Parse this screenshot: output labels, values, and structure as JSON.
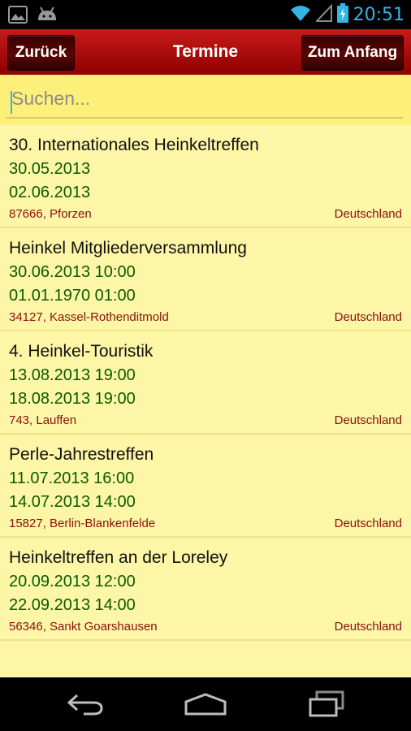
{
  "status_bar": {
    "time": "20:51",
    "icons": [
      "gallery-icon",
      "android-icon",
      "wifi-icon",
      "signal-icon",
      "battery-charging-icon"
    ]
  },
  "app_bar": {
    "back_label": "Zurück",
    "title": "Termine",
    "home_label": "Zum Anfang"
  },
  "search": {
    "placeholder": "Suchen..."
  },
  "events": [
    {
      "title": "30. Internationales Heinkeltreffen",
      "start": "30.05.2013",
      "end": "02.06.2013",
      "place": "87666, Pforzen",
      "country": "Deutschland"
    },
    {
      "title": "Heinkel Mitgliederversammlung",
      "start": "30.06.2013 10:00",
      "end": "01.01.1970 01:00",
      "place": "34127, Kassel-Rothenditmold",
      "country": "Deutschland"
    },
    {
      "title": "4. Heinkel-Touristik",
      "start": "13.08.2013 19:00",
      "end": "18.08.2013 19:00",
      "place": "743, Lauffen",
      "country": "Deutschland"
    },
    {
      "title": "Perle-Jahrestreffen",
      "start": "11.07.2013 16:00",
      "end": "14.07.2013 14:00",
      "place": "15827, Berlin-Blankenfelde",
      "country": "Deutschland"
    },
    {
      "title": "Heinkeltreffen an der Loreley",
      "start": "20.09.2013 12:00",
      "end": "22.09.2013 14:00",
      "place": "56346, Sankt Goarshausen",
      "country": "Deutschland"
    }
  ],
  "nav_bar": {
    "icons": [
      "back-nav-icon",
      "home-nav-icon",
      "recent-apps-icon"
    ]
  },
  "colors": {
    "app_bar": "#b50000",
    "background": "#fdf6a6",
    "search_background": "#fdf07a",
    "date_text": "#0a5a00",
    "place_text": "#8b1010",
    "status_accent": "#33b5e5"
  }
}
